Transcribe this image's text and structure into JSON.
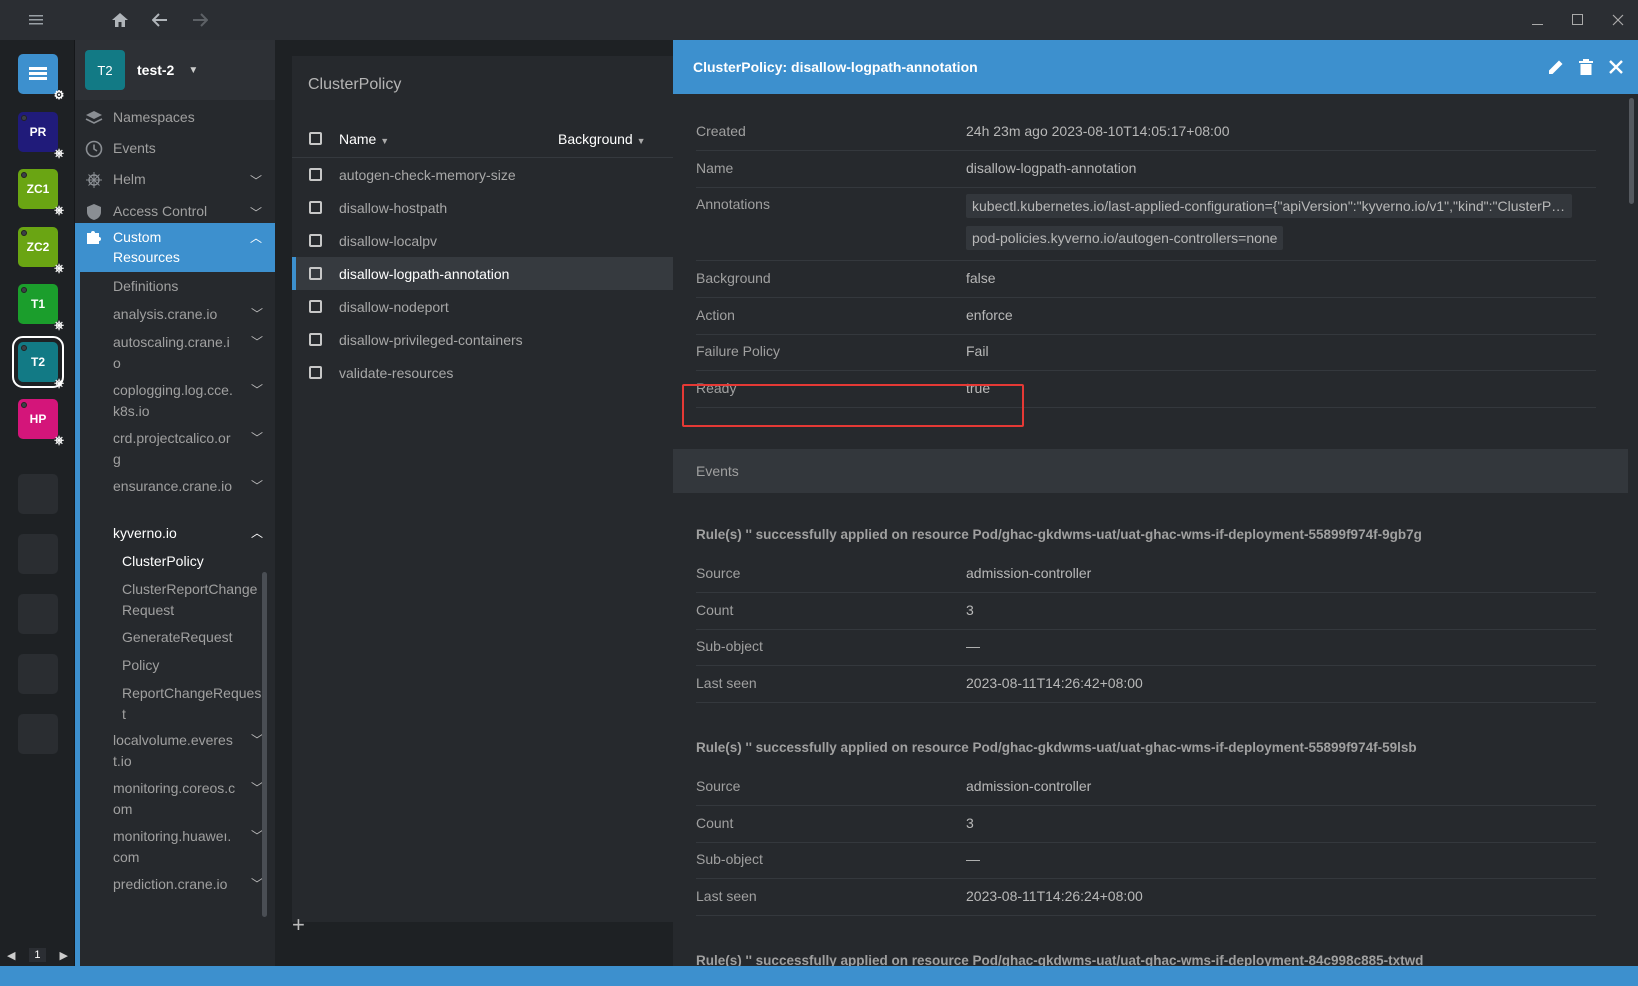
{
  "app": {
    "status_color": "#3d90ce"
  },
  "hotbar": {
    "clusters": [
      {
        "label": "",
        "color": "#3d90ce",
        "icon": "catalog-icon"
      },
      {
        "label": "PR",
        "color": "#201b7a"
      },
      {
        "label": "ZC1",
        "color": "#6aa513"
      },
      {
        "label": "ZC2",
        "color": "#6aa513"
      },
      {
        "label": "T1",
        "color": "#1b9e2c"
      },
      {
        "label": "T2",
        "color": "#127a85"
      },
      {
        "label": "HP",
        "color": "#d4157a"
      }
    ],
    "page": "1"
  },
  "sidebar": {
    "cluster_avatar": "T2",
    "cluster_name": "test-2",
    "items": [
      {
        "label": "Namespaces"
      },
      {
        "label": "Events"
      },
      {
        "label": "Helm"
      },
      {
        "label": "Access Control"
      },
      {
        "label": "Custom Resources"
      }
    ],
    "crd": {
      "definitions": "Definitions",
      "groups": [
        "analysis.crane.io",
        "autoscaling.crane.io",
        "coplogging.log.cce.k8s.io",
        "crd.projectcalico.org",
        "ensurance.crane.io"
      ],
      "kyverno": "kyverno.io",
      "kyverno_items": [
        "ClusterPolicy",
        "ClusterReportChangeRequest",
        "GenerateRequest",
        "Policy",
        "ReportChangeRequest"
      ],
      "groups_after": [
        "localvolume.everest.io",
        "monitoring.coreos.com",
        "monitoring.huaweı.com",
        "prediction.crane.io"
      ]
    }
  },
  "list": {
    "title": "ClusterPolicy",
    "col_name": "Name",
    "col_background": "Background",
    "rows": [
      "autogen-check-memory-size",
      "disallow-hostpath",
      "disallow-localpv",
      "disallow-logpath-annotation",
      "disallow-nodeport",
      "disallow-privileged-containers",
      "validate-resources"
    ],
    "add": "+"
  },
  "drawer": {
    "title": "ClusterPolicy: disallow-logpath-annotation",
    "fields": {
      "created_k": "Created",
      "created_v": "24h 23m ago 2023-08-10T14:05:17+08:00",
      "name_k": "Name",
      "name_v": "disallow-logpath-annotation",
      "annotations_k": "Annotations",
      "annotation_1": "kubectl.kubernetes.io/last-applied-configuration={\"apiVersion\":\"kyverno.io/v1\",\"kind\":\"ClusterPolicy\"...",
      "annotation_2": "pod-policies.kyverno.io/autogen-controllers=none",
      "background_k": "Background",
      "background_v": "false",
      "action_k": "Action",
      "action_v": "enforce",
      "failure_k": "Failure Policy",
      "failure_v": "Fail",
      "ready_k": "Ready",
      "ready_v": "true"
    },
    "events_title": "Events",
    "events": [
      {
        "title": "Rule(s) '' successfully applied on resource Pod/ghac-gkdwms-uat/uat-ghac-wms-if-deployment-55899f974f-9gb7g",
        "source": "admission-controller",
        "count": "3",
        "subobject": "—",
        "last_seen": "2023-08-11T14:26:42+08:00"
      },
      {
        "title": "Rule(s) '' successfully applied on resource Pod/ghac-gkdwms-uat/uat-ghac-wms-if-deployment-55899f974f-59lsb",
        "source": "admission-controller",
        "count": "3",
        "subobject": "—",
        "last_seen": "2023-08-11T14:26:24+08:00"
      },
      {
        "title": "Rule(s) '' successfully applied on resource Pod/ghac-gkdwms-uat/uat-ghac-wms-if-deployment-84c998c885-txtwd"
      }
    ],
    "labels": {
      "source": "Source",
      "count": "Count",
      "subobject": "Sub-object",
      "last_seen": "Last seen"
    }
  }
}
